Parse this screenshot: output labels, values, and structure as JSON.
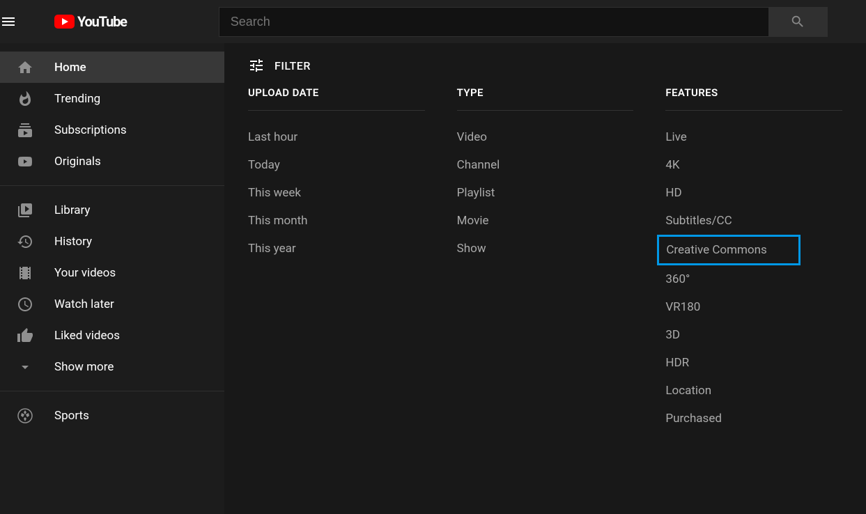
{
  "header": {
    "logo_text": "YouTube",
    "search_placeholder": "Search"
  },
  "sidebar": {
    "primary": [
      {
        "label": "Home",
        "icon": "home",
        "active": true
      },
      {
        "label": "Trending",
        "icon": "flame",
        "active": false
      },
      {
        "label": "Subscriptions",
        "icon": "subscriptions",
        "active": false
      },
      {
        "label": "Originals",
        "icon": "originals",
        "active": false
      }
    ],
    "secondary": [
      {
        "label": "Library",
        "icon": "library"
      },
      {
        "label": "History",
        "icon": "history"
      },
      {
        "label": "Your videos",
        "icon": "yourvideos"
      },
      {
        "label": "Watch later",
        "icon": "clock"
      },
      {
        "label": "Liked videos",
        "icon": "thumb"
      },
      {
        "label": "Show more",
        "icon": "chevron"
      }
    ],
    "extra": [
      {
        "label": "Sports",
        "icon": "sports"
      }
    ]
  },
  "filter": {
    "button_label": "FILTER",
    "columns": [
      {
        "title": "UPLOAD DATE",
        "options": [
          {
            "label": "Last hour"
          },
          {
            "label": "Today"
          },
          {
            "label": "This week"
          },
          {
            "label": "This month"
          },
          {
            "label": "This year"
          }
        ]
      },
      {
        "title": "TYPE",
        "options": [
          {
            "label": "Video"
          },
          {
            "label": "Channel"
          },
          {
            "label": "Playlist"
          },
          {
            "label": "Movie"
          },
          {
            "label": "Show"
          }
        ]
      },
      {
        "title": "FEATURES",
        "options": [
          {
            "label": "Live"
          },
          {
            "label": "4K"
          },
          {
            "label": "HD"
          },
          {
            "label": "Subtitles/CC"
          },
          {
            "label": "Creative Commons",
            "highlighted": true
          },
          {
            "label": "360°"
          },
          {
            "label": "VR180"
          },
          {
            "label": "3D"
          },
          {
            "label": "HDR"
          },
          {
            "label": "Location"
          },
          {
            "label": "Purchased"
          }
        ]
      }
    ]
  }
}
